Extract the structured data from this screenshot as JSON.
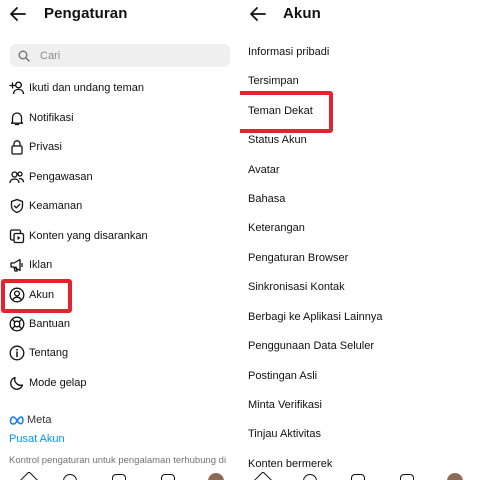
{
  "left_panel": {
    "title": "Pengaturan",
    "search_placeholder": "Cari",
    "items": [
      {
        "label": "Ikuti dan undang teman",
        "icon": "add-person-icon"
      },
      {
        "label": "Notifikasi",
        "icon": "bell-icon"
      },
      {
        "label": "Privasi",
        "icon": "lock-icon"
      },
      {
        "label": "Pengawasan",
        "icon": "people-icon"
      },
      {
        "label": "Keamanan",
        "icon": "shield-icon"
      },
      {
        "label": "Konten yang disarankan",
        "icon": "suggested-content-icon"
      },
      {
        "label": "Iklan",
        "icon": "megaphone-icon"
      },
      {
        "label": "Akun",
        "icon": "account-circle-icon"
      },
      {
        "label": "Bantuan",
        "icon": "lifebuoy-icon"
      },
      {
        "label": "Tentang",
        "icon": "info-icon"
      },
      {
        "label": "Mode gelap",
        "icon": "moon-icon"
      }
    ],
    "meta_brand": "Meta",
    "pusat_akun": "Pusat Akun",
    "footer_text": "Kontrol pengaturan untuk pengalaman terhubung di"
  },
  "right_panel": {
    "title": "Akun",
    "items": [
      "Informasi pribadi",
      "Tersimpan",
      "Teman Dekat",
      "Status Akun",
      "Avatar",
      "Bahasa",
      "Keterangan",
      "Pengaturan Browser",
      "Sinkronisasi Kontak",
      "Berbagi ke Aplikasi Lainnya",
      "Penggunaan Data Seluler",
      "Postingan Asli",
      "Minta Verifikasi",
      "Tinjau Aktivitas",
      "Konten bermerek"
    ]
  },
  "colors": {
    "highlight": "#e5232e",
    "link": "#0095f6",
    "search_bg": "#efefef",
    "meta_blue": "#0a7cff"
  }
}
